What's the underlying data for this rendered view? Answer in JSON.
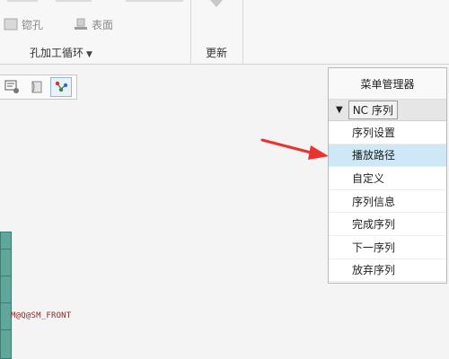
{
  "ribbon": {
    "row_items": [
      {
        "label": "锪孔",
        "icon": "countersink-icon"
      },
      {
        "label": "表面",
        "icon": "surface-icon"
      }
    ],
    "group_label": "孔加工循环",
    "update_label": "更新"
  },
  "mini_toolbar": {
    "buttons": [
      "sequence-setup-icon",
      "tool-path-icon",
      "nc-sequence-icon"
    ]
  },
  "model": {
    "label": "M@Q@SM_FRONT"
  },
  "menu": {
    "title": "菜单管理器",
    "header": "NC 序列",
    "items": [
      {
        "label": "序列设置",
        "highlighted": false
      },
      {
        "label": "播放路径",
        "highlighted": true
      },
      {
        "label": "自定义",
        "highlighted": false
      },
      {
        "label": "序列信息",
        "highlighted": false
      },
      {
        "label": "完成序列",
        "highlighted": false
      },
      {
        "label": "下一序列",
        "highlighted": false
      },
      {
        "label": "放弃序列",
        "highlighted": false
      }
    ]
  },
  "colors": {
    "arrow": "#e8332e",
    "highlight": "#cfe8f7",
    "model": "#5fa79a"
  }
}
